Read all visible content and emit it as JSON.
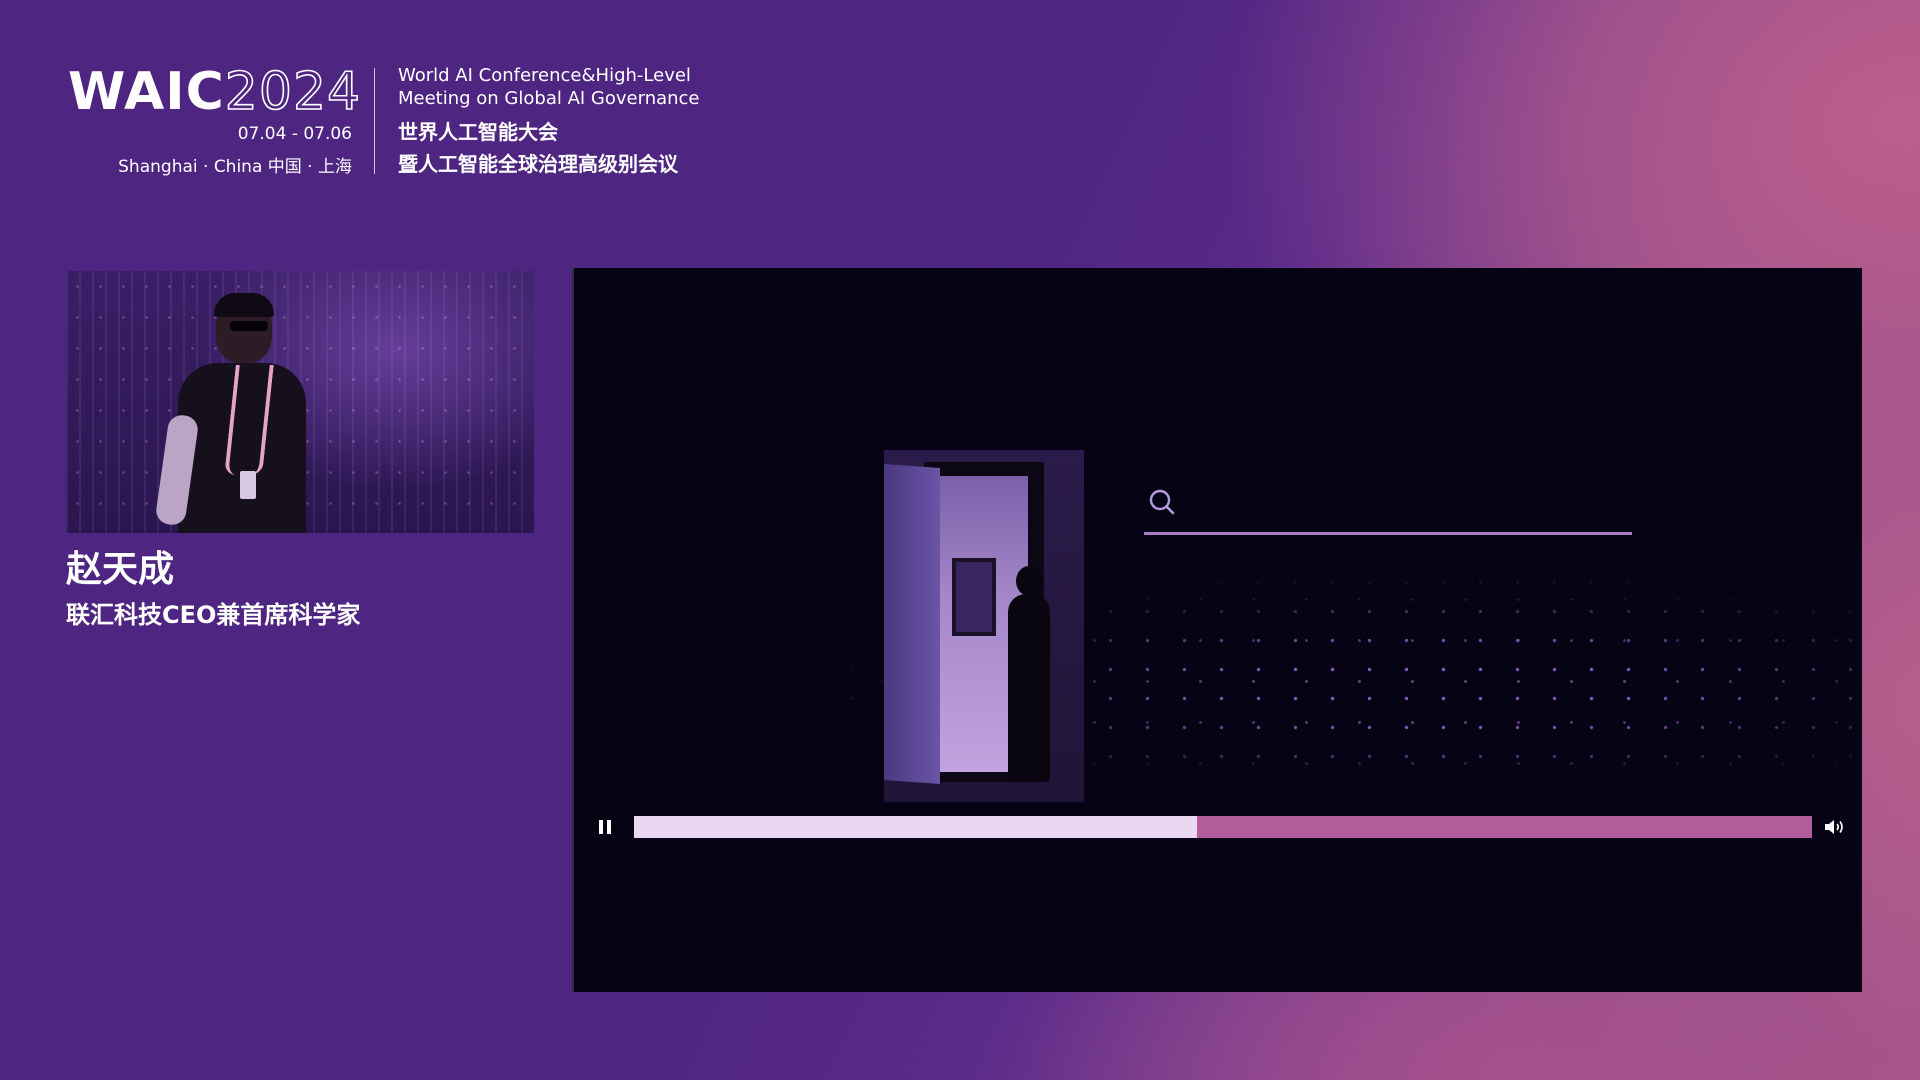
{
  "header": {
    "logo_waic": "WAIC",
    "logo_year": "2024",
    "dates": "07.04 - 07.06",
    "place": "Shanghai · China  中国 · 上海",
    "conference_en_line1": "World AI Conference&High-Level",
    "conference_en_line2": "Meeting on Global AI Governance",
    "conference_cn_line1": "世界人工智能大会",
    "conference_cn_line2": "暨人工智能全球治理高级别会议"
  },
  "speaker": {
    "name": "赵天成",
    "title": "联汇科技CEO兼首席科学家"
  },
  "video": {
    "search": {
      "value": "",
      "placeholder": ""
    },
    "controls": {
      "progress_fraction": 0.478,
      "playing": true,
      "play_pause_icon": "pause-icon",
      "volume_icon": "volume-icon"
    }
  },
  "colors": {
    "background": "#4e2580",
    "accent_pink": "#b05f87",
    "progress_played": "#ead8f2",
    "progress_remaining": "#b35c9c",
    "video_background": "#060314"
  }
}
